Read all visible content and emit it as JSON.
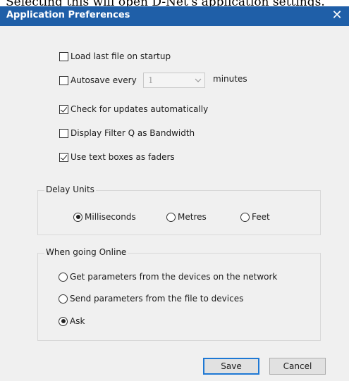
{
  "caption": "Selecting this will open D-Net's application settings.",
  "window": {
    "title": "Application Preferences",
    "close_glyph": "✕"
  },
  "options": [
    {
      "label": "Load last file on startup",
      "checked": false
    },
    {
      "label": "Autosave every",
      "checked": false
    },
    {
      "label": "Check for updates automatically",
      "checked": true
    },
    {
      "label": "Display Filter Q as Bandwidth",
      "checked": false
    },
    {
      "label": "Use text boxes as faders",
      "checked": true
    }
  ],
  "autosave": {
    "value": "1",
    "unit": "minutes"
  },
  "delay_units": {
    "label": "Delay Units",
    "options": [
      "Milliseconds",
      "Metres",
      "Feet"
    ],
    "selected": "Milliseconds"
  },
  "online": {
    "label": "When going Online",
    "options": [
      "Get parameters from the devices on the network",
      "Send parameters from the file to devices",
      "Ask"
    ],
    "selected": "Ask"
  },
  "buttons": {
    "save": "Save",
    "cancel": "Cancel"
  },
  "colors": {
    "titlebar": "#1f5fa8",
    "dialog_bg": "#f0f0f0",
    "default_button_border": "#1e78d4"
  }
}
